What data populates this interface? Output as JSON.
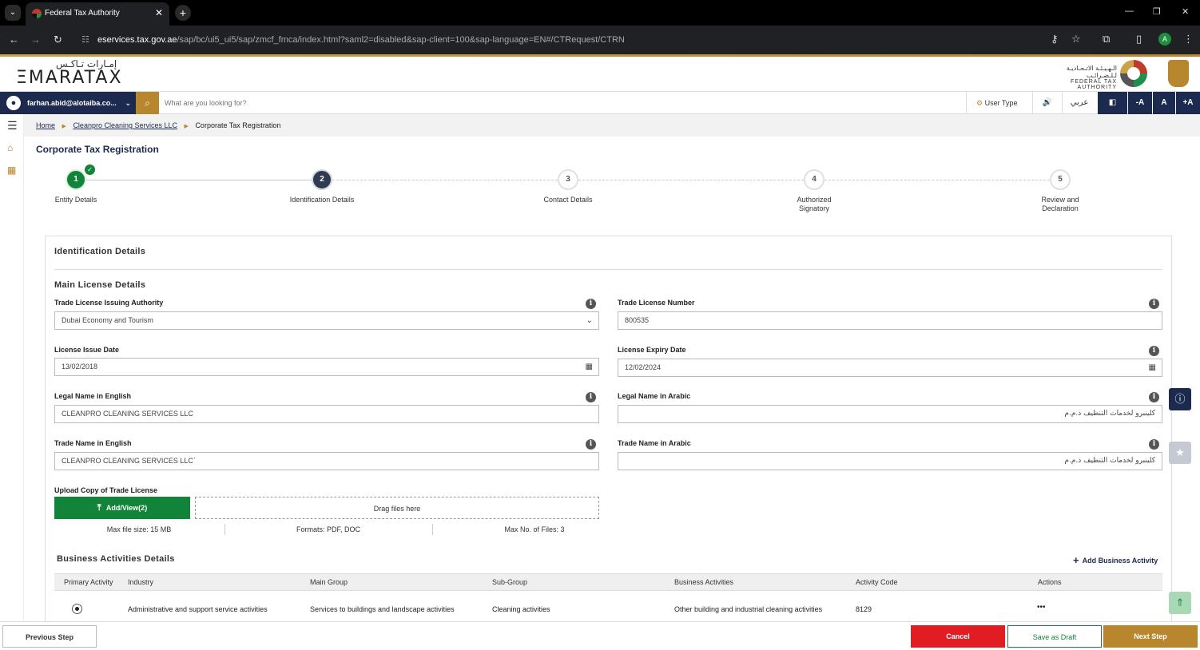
{
  "browser": {
    "tab_title": "Federal Tax Authority",
    "url_host": "eservices.tax.gov.ae",
    "url_path": "/sap/bc/ui5_ui5/sap/zmcf_fmca/index.html?saml2=disabled&sap-client=100&sap-language=EN#/CTRequest/CTRN",
    "profile_initial": "A"
  },
  "header": {
    "logo_ar": "إمـارات تـاكـس",
    "logo_en": "ΞMARATAX",
    "fta_ar": "الـهـيـئـة الاتـحـاديـة لـلـضـرائـب",
    "fta_en": "FEDERAL TAX AUTHORITY"
  },
  "topbar": {
    "user_email": "farhan.abid@alotaiba.co...",
    "search_placeholder": "What are you looking for?",
    "user_type": "User Type",
    "lang": "عربي",
    "font_minus": "-A",
    "font_normal": "A",
    "font_plus": "+A"
  },
  "breadcrumb": {
    "home": "Home",
    "company": "Cleanpro Cleaning Services LLC",
    "current": "Corporate Tax Registration"
  },
  "page_title": "Corporate Tax Registration",
  "steps": [
    {
      "num": "1",
      "label": "Entity Details",
      "state": "done"
    },
    {
      "num": "2",
      "label": "Identification Details",
      "state": "active"
    },
    {
      "num": "3",
      "label": "Contact Details",
      "state": "pending"
    },
    {
      "num": "4",
      "label": "Authorized Signatory",
      "state": "pending"
    },
    {
      "num": "5",
      "label": "Review and Declaration",
      "state": "pending"
    }
  ],
  "form": {
    "section_title": "Identification Details",
    "sub_title": "Main License Details",
    "fields": {
      "issuing_authority": {
        "label": "Trade License Issuing Authority",
        "value": "Dubai Economy and Tourism"
      },
      "license_number": {
        "label": "Trade License Number",
        "value": "800535"
      },
      "issue_date": {
        "label": "License Issue Date",
        "value": "13/02/2018"
      },
      "expiry_date": {
        "label": "License Expiry Date",
        "value": "12/02/2024"
      },
      "legal_name_en": {
        "label": "Legal Name in English",
        "value": "CLEANPRO CLEANING SERVICES LLC"
      },
      "legal_name_ar": {
        "label": "Legal Name in Arabic",
        "value": "كلينبرو لخدمات التنظيف ذ.م.م"
      },
      "trade_name_en": {
        "label": "Trade Name in English",
        "value": "CLEANPRO CLEANING SERVICES LLC`"
      },
      "trade_name_ar": {
        "label": "Trade Name in Arabic",
        "value": "كلينبرو لخدمات التنظيف ذ.م.م"
      }
    },
    "upload": {
      "label": "Upload Copy of Trade License",
      "button": "Add/View(2)",
      "drop": "Drag files here",
      "max_size": "Max file size: 15 MB",
      "formats": "Formats: PDF, DOC",
      "max_files": "Max No. of Files: 3"
    }
  },
  "business_activities": {
    "title": "Business Activities Details",
    "add_label": "Add Business Activity",
    "columns": [
      "Primary Activity",
      "Industry",
      "Main Group",
      "Sub-Group",
      "Business Activities",
      "Activity Code",
      "Actions"
    ],
    "rows": [
      {
        "primary": true,
        "industry": "Administrative and support service activities",
        "main_group": "Services to buildings and landscape activities",
        "sub_group": "Cleaning activities",
        "activity": "Other building and industrial cleaning activities",
        "code": "8129",
        "actions": "•••"
      }
    ]
  },
  "footer": {
    "previous": "Previous Step",
    "cancel": "Cancel",
    "draft": "Save as Draft",
    "next": "Next Step"
  },
  "colors": {
    "navy": "#1b2a4e",
    "gold": "#b8862d",
    "green": "#12843a",
    "red": "#e21c23"
  }
}
